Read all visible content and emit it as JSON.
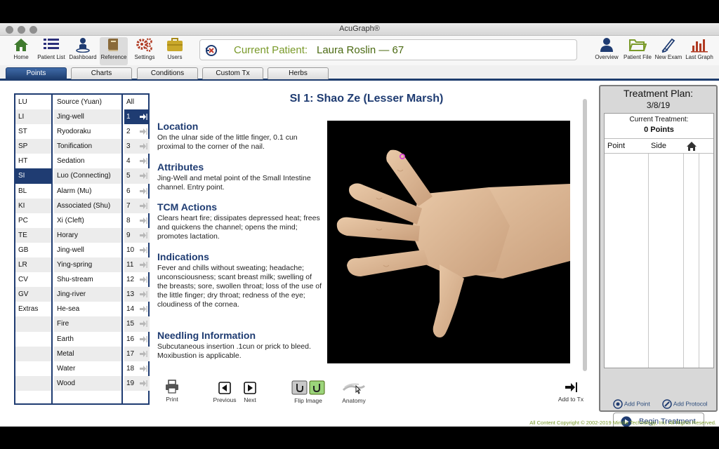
{
  "window": {
    "title": "AcuGraph®"
  },
  "toolbar": {
    "left": [
      {
        "label": "Home",
        "icon": "home-icon"
      },
      {
        "label": "Patient List",
        "icon": "list-icon"
      },
      {
        "label": "Dashboard",
        "icon": "dashboard-icon"
      },
      {
        "label": "Reference",
        "icon": "book-icon"
      },
      {
        "label": "Settings",
        "icon": "gears-icon"
      },
      {
        "label": "Users",
        "icon": "briefcase-icon"
      }
    ],
    "right": [
      {
        "label": "Overview",
        "icon": "person-icon"
      },
      {
        "label": "Patient File",
        "icon": "folder-icon"
      },
      {
        "label": "New Exam",
        "icon": "pen-icon"
      },
      {
        "label": "Last Graph",
        "icon": "bar-chart-icon"
      }
    ],
    "patient_label": "Current Patient:",
    "patient_name": "Laura Roslin — 67"
  },
  "tabs": [
    {
      "label": "Points",
      "active": true
    },
    {
      "label": "Charts",
      "active": false
    },
    {
      "label": "Conditions",
      "active": false
    },
    {
      "label": "Custom Tx",
      "active": false
    },
    {
      "label": "Herbs",
      "active": false
    }
  ],
  "meridians": [
    "LU",
    "LI",
    "ST",
    "SP",
    "HT",
    "SI",
    "BL",
    "KI",
    "PC",
    "TE",
    "GB",
    "LR",
    "CV",
    "GV",
    "Extras"
  ],
  "selected_meridian": "SI",
  "categories": [
    "Source (Yuan)",
    "Jing-well",
    "Ryodoraku",
    "Tonification",
    "Sedation",
    "Luo (Connecting)",
    "Alarm (Mu)",
    "Associated (Shu)",
    "Xi (Cleft)",
    "Horary",
    "Jing-well",
    "Ying-spring",
    "Shu-stream",
    "Jing-river",
    "He-sea",
    "Fire",
    "Earth",
    "Metal",
    "Water",
    "Wood"
  ],
  "numbers": [
    "All",
    "1",
    "2",
    "3",
    "4",
    "5",
    "6",
    "7",
    "8",
    "9",
    "10",
    "11",
    "12",
    "13",
    "14",
    "15",
    "16",
    "17",
    "18",
    "19"
  ],
  "selected_number": "1",
  "point": {
    "title": "SI 1: Shao Ze (Lesser Marsh)",
    "sections": [
      {
        "heading": "Location",
        "text": "On the ulnar side of the little finger, 0.1 cun proximal to the corner of the nail."
      },
      {
        "heading": "Attributes",
        "text": "Jing-Well and metal point of the Small Intestine channel. Entry point."
      },
      {
        "heading": "TCM Actions",
        "text": "Clears heart fire; dissipates depressed heat; frees and quickens the channel; opens the mind; promotes lactation."
      },
      {
        "heading": "Indications",
        "text": "Fever and chills without sweating; headache; unconsciousness; scant breast milk; swelling of the breasts; sore, swollen throat; loss of the use of the little finger; dry throat; redness of the eye; cloudiness of the cornea."
      },
      {
        "heading": "Needling Information",
        "text": "Subcutaneous insertion .1cun or prick to bleed. Moxibustion is applicable."
      }
    ]
  },
  "bottom_tools": {
    "print": "Print",
    "previous": "Previous",
    "next": "Next",
    "flip": "Flip Image",
    "anatomy": "Anatomy",
    "add_to_tx": "Add to Tx"
  },
  "treatment_plan": {
    "title": "Treatment Plan:",
    "date": "3/8/19",
    "current_label": "Current Treatment:",
    "count": "0 Points",
    "col_point": "Point",
    "col_side": "Side",
    "add_point": "Add Point",
    "add_protocol": "Add Protocol",
    "begin": "Begin Treatment"
  },
  "footer": {
    "copyright": "All Content Copyright © 2002-2019 Miridia Technology, Inc.  All Rights Reserved."
  },
  "colors": {
    "navy": "#1f3c72",
    "green": "#7a9a2a",
    "dark_green": "#4b6a12"
  }
}
